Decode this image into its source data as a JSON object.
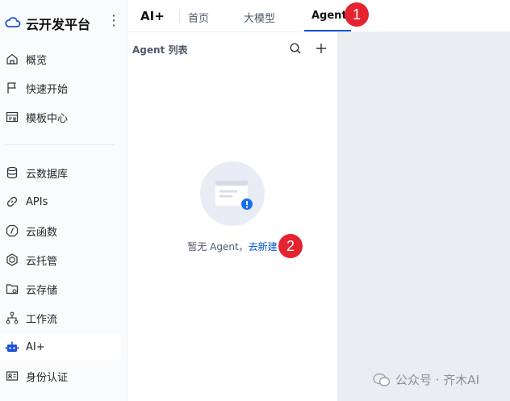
{
  "brand": {
    "title": "云开发平台",
    "more": "⋮"
  },
  "sidebar": {
    "items": [
      {
        "label": "概览",
        "icon": "home-icon"
      },
      {
        "label": "快速开始",
        "icon": "flag-icon"
      },
      {
        "label": "模板中心",
        "icon": "template-icon"
      },
      {
        "label": "云数据库",
        "icon": "database-icon"
      },
      {
        "label": "APIs",
        "icon": "link-icon"
      },
      {
        "label": "云函数",
        "icon": "function-icon"
      },
      {
        "label": "云托管",
        "icon": "hexagon-icon"
      },
      {
        "label": "云存储",
        "icon": "folder-icon"
      },
      {
        "label": "工作流",
        "icon": "workflow-icon"
      },
      {
        "label": "AI+",
        "icon": "robot-icon",
        "active": true
      },
      {
        "label": "身份认证",
        "icon": "id-card-icon"
      }
    ]
  },
  "tabs": {
    "title": "AI+",
    "items": [
      {
        "label": "首页"
      },
      {
        "label": "大模型"
      },
      {
        "label": "Agent",
        "active": true
      }
    ]
  },
  "panel": {
    "title": "Agent 列表",
    "empty_text": "暂无 Agent，",
    "empty_link": "去新建"
  },
  "markers": [
    "1",
    "2"
  ],
  "watermark": {
    "text": "公众号 · 齐木AI"
  },
  "colors": {
    "accent": "#0052d9",
    "marker": "#e5222f",
    "right_bg": "#ebedf1"
  }
}
